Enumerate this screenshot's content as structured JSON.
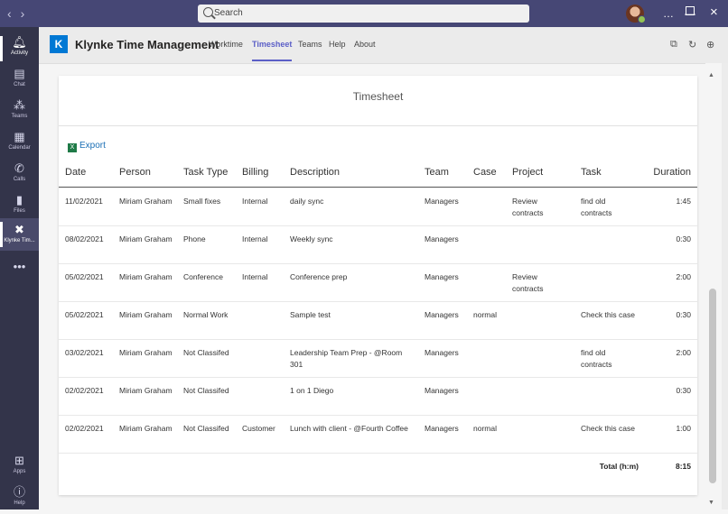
{
  "titlebar": {
    "search_placeholder": "Search"
  },
  "rail": [
    {
      "label": "Activity",
      "icon": "bell-icon"
    },
    {
      "label": "Chat",
      "icon": "chat-icon"
    },
    {
      "label": "Teams",
      "icon": "teams-icon"
    },
    {
      "label": "Calendar",
      "icon": "calendar-icon"
    },
    {
      "label": "Calls",
      "icon": "phone-icon"
    },
    {
      "label": "Files",
      "icon": "file-icon"
    },
    {
      "label": "Klynke Tim...",
      "icon": "klynke-icon"
    }
  ],
  "rail_bottom": [
    {
      "label": "Apps",
      "icon": "apps-icon"
    },
    {
      "label": "Help",
      "icon": "help-icon"
    }
  ],
  "app": {
    "title": "Klynke Time Management",
    "logo_text": "K",
    "tabs": [
      "Worktime",
      "Timesheet",
      "Teams",
      "Help",
      "About"
    ],
    "active_tab": "Timesheet"
  },
  "sheet": {
    "title": "Timesheet",
    "export_label": "Export",
    "columns": [
      "Date",
      "Person",
      "Task Type",
      "Billing",
      "Description",
      "Team",
      "Case",
      "Project",
      "Task",
      "Duration"
    ],
    "rows": [
      {
        "date": "11/02/2021",
        "person": "Miriam Graham",
        "task_type": "Small fixes",
        "billing": "Internal",
        "description": "daily sync",
        "team": "Managers",
        "case": "",
        "project": "Review contracts",
        "task": "find old contracts",
        "duration": "1:45"
      },
      {
        "date": "08/02/2021",
        "person": "Miriam Graham",
        "task_type": "Phone",
        "billing": "Internal",
        "description": "Weekly sync",
        "team": "Managers",
        "case": "",
        "project": "",
        "task": "",
        "duration": "0:30"
      },
      {
        "date": "05/02/2021",
        "person": "Miriam Graham",
        "task_type": "Conference",
        "billing": "Internal",
        "description": "Conference prep",
        "team": "Managers",
        "case": "",
        "project": "Review contracts",
        "task": "",
        "duration": "2:00"
      },
      {
        "date": "05/02/2021",
        "person": "Miriam Graham",
        "task_type": "Normal Work",
        "billing": "",
        "description": "Sample test",
        "team": "Managers",
        "case": "normal",
        "project": "",
        "task": "Check this case",
        "duration": "0:30"
      },
      {
        "date": "03/02/2021",
        "person": "Miriam Graham",
        "task_type": "Not Classifed",
        "billing": "",
        "description": "Leadership Team Prep - @Room 301",
        "team": "Managers",
        "case": "",
        "project": "",
        "task": "find old contracts",
        "duration": "2:00"
      },
      {
        "date": "02/02/2021",
        "person": "Miriam Graham",
        "task_type": "Not Classifed",
        "billing": "",
        "description": "1 on 1 Diego",
        "team": "Managers",
        "case": "",
        "project": "",
        "task": "",
        "duration": "0:30"
      },
      {
        "date": "02/02/2021",
        "person": "Miriam Graham",
        "task_type": "Not Classifed",
        "billing": "Customer",
        "description": "Lunch with client - @Fourth Coffee",
        "team": "Managers",
        "case": "normal",
        "project": "",
        "task": "Check this case",
        "duration": "1:00"
      }
    ],
    "total_label": "Total (h:m)",
    "total_value": "8:15"
  },
  "colors": {
    "titlebar": "#464775",
    "rail": "#33344a",
    "accent": "#5b5fc7",
    "logo": "#0078d4",
    "link": "#1a6fb5"
  }
}
